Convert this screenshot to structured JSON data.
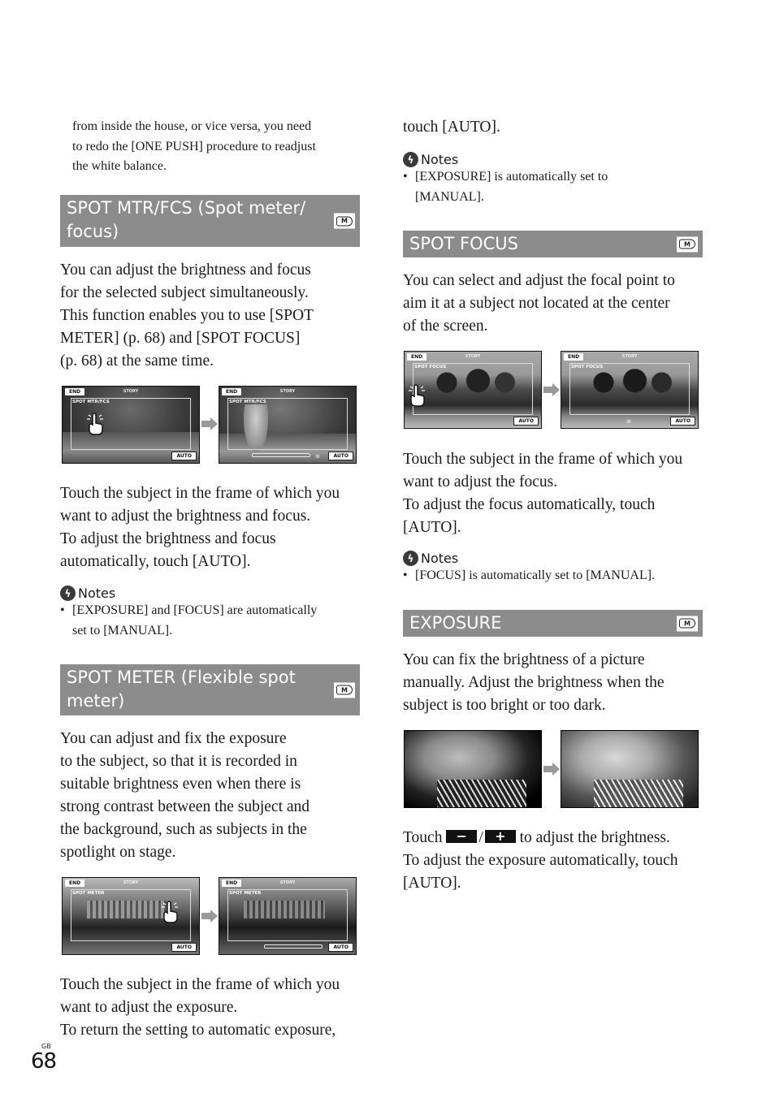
{
  "left_column": {
    "intro_continuation": "from inside the house, or vice versa, you need\nto redo the [ONE PUSH] procedure to readjust\nthe white balance.",
    "spot_mtr_fcs": {
      "title": "SPOT MTR/FCS (Spot meter/\nfocus)",
      "mode_icon": "M",
      "description": "You can adjust the brightness and focus\nfor the selected subject simultaneously.\nThis function enables you to use [SPOT\nMETER] (p. 68) and [SPOT FOCUS]\n(p. 68) at the same time.",
      "screens": [
        {
          "end": "END",
          "story": "STORY",
          "label": "SPOT MTR/FCS",
          "auto": "AUTO",
          "has_hand": true,
          "has_slider": false
        },
        {
          "end": "END",
          "story": "STORY",
          "label": "SPOT MTR/FCS",
          "auto": "AUTO",
          "has_hand": false,
          "has_slider": true
        }
      ],
      "instructions": "Touch the subject in the frame of which you\nwant to adjust the brightness and focus.\nTo adjust the brightness and focus\nautomatically, touch [AUTO].",
      "notes_title": "Notes",
      "notes": [
        "[EXPOSURE] and [FOCUS] are automatically\nset to [MANUAL]."
      ]
    },
    "spot_meter": {
      "title": "SPOT METER (Flexible spot\nmeter)",
      "mode_icon": "M",
      "description": "You can adjust and fix the exposure\nto the subject, so that it is recorded in\nsuitable brightness even when there is\nstrong contrast between the subject and\nthe background, such as subjects in the\nspotlight on stage.",
      "screens": [
        {
          "end": "END",
          "story": "STORY",
          "label": "SPOT METER",
          "auto": "AUTO"
        },
        {
          "end": "END",
          "story": "STORY",
          "label": "SPOT METER",
          "auto": "AUTO"
        }
      ],
      "instructions": "Touch the subject in the frame of which you\nwant to adjust the exposure.\nTo return the setting to automatic exposure,"
    }
  },
  "right_column": {
    "continuation": "touch [AUTO].",
    "notes_title": "Notes",
    "notes": [
      "[EXPOSURE] is automatically set to\n[MANUAL]."
    ],
    "spot_focus": {
      "title": "SPOT FOCUS",
      "mode_icon": "M",
      "description": "You can select and adjust the focal point to\naim it at a subject not located at the center\nof the screen.",
      "screens": [
        {
          "end": "END",
          "story": "STORY",
          "label": "SPOT FOCUS",
          "auto": "AUTO"
        },
        {
          "end": "END",
          "story": "STORY",
          "label": "SPOT FOCUS",
          "auto": "AUTO"
        }
      ],
      "instructions": "Touch the subject in the frame of which you\nwant to adjust the focus.\nTo adjust the focus automatically, touch\n[AUTO].",
      "notes_title": "Notes",
      "notes": [
        "[FOCUS] is automatically set to [MANUAL]."
      ]
    },
    "exposure": {
      "title": "EXPOSURE",
      "mode_icon": "M",
      "description": "You can fix the brightness of a picture\nmanually. Adjust the brightness when the\nsubject is too bright or too dark.",
      "instruction_prefix": "Touch",
      "minus_button": "−",
      "separator": "/",
      "plus_button": "+",
      "instruction_suffix": "to adjust the brightness.",
      "instruction_line2": "To adjust the exposure automatically, touch\n[AUTO]."
    }
  },
  "footer": {
    "language_code": "GB",
    "page_number": "68"
  },
  "colors": {
    "section_header_bg": "#8c8c8c",
    "section_header_text": "#ffffff",
    "body_text": "#1a1a1a"
  }
}
